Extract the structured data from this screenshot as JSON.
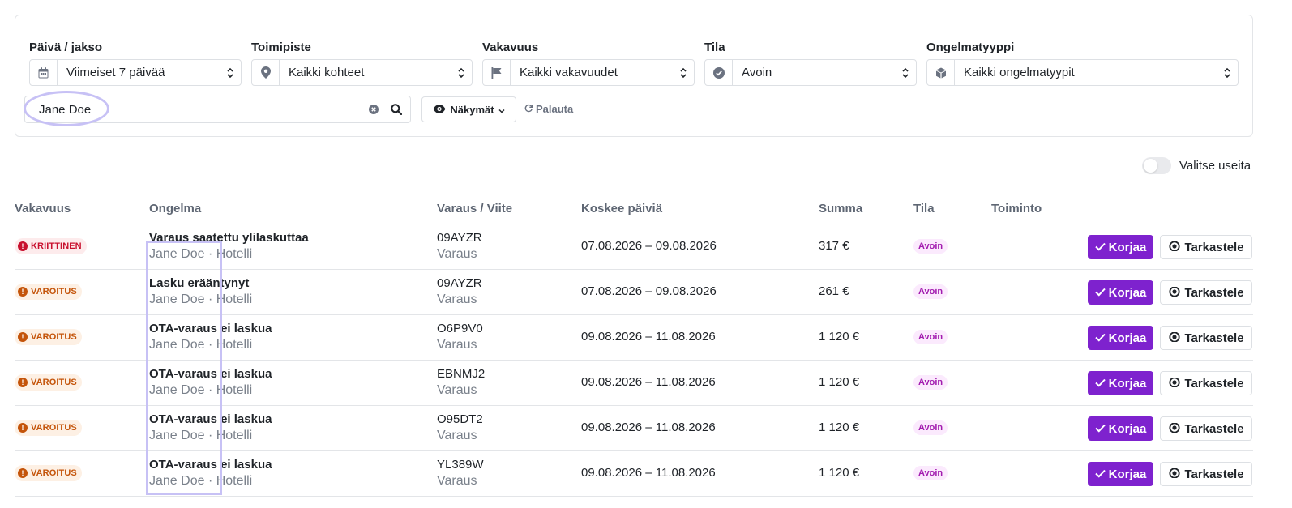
{
  "filters": {
    "date": {
      "label": "Päivä / jakso",
      "value": "Viimeiset 7 päivää",
      "icon": "calendar-icon"
    },
    "location": {
      "label": "Toimipiste",
      "value": "Kaikki kohteet",
      "icon": "map-pin-icon"
    },
    "severity": {
      "label": "Vakavuus",
      "value": "Kaikki vakavuudet",
      "icon": "flag-icon"
    },
    "status": {
      "label": "Tila",
      "value": "Avoin",
      "icon": "check-circle-icon"
    },
    "issue_type": {
      "label": "Ongelmatyyppi",
      "value": "Kaikki ongelmatyypit",
      "icon": "cube-icon"
    }
  },
  "search": {
    "value": "Jane Doe",
    "placeholder": ""
  },
  "views_button": {
    "label": "Näkymät"
  },
  "reset_link": {
    "label": "Palauta"
  },
  "multi_select": {
    "label": "Valitse useita",
    "enabled": false
  },
  "table": {
    "headers": {
      "severity": "Vakavuus",
      "problem": "Ongelma",
      "reference": "Varaus / Viite",
      "dates": "Koskee päiviä",
      "amount": "Summa",
      "status": "Tila",
      "action": "Toiminto"
    },
    "rows": [
      {
        "severity": "KRIITTINEN",
        "severity_level": "critical",
        "title": "Varaus saatettu ylilaskuttaa",
        "subtitle": "Jane Doe · Hotelli",
        "ref_code": "09AYZR",
        "ref_type": "Varaus",
        "dates": "07.08.2026 – 09.08.2026",
        "amount": "317 €",
        "status": "Avoin",
        "fix_label": "Korjaa",
        "view_label": "Tarkastele"
      },
      {
        "severity": "VAROITUS",
        "severity_level": "warning",
        "title": "Lasku erääntynyt",
        "subtitle": "Jane Doe · Hotelli",
        "ref_code": "09AYZR",
        "ref_type": "Varaus",
        "dates": "07.08.2026 – 09.08.2026",
        "amount": "261 €",
        "status": "Avoin",
        "fix_label": "Korjaa",
        "view_label": "Tarkastele"
      },
      {
        "severity": "VAROITUS",
        "severity_level": "warning",
        "title": "OTA-varaus ei laskua",
        "subtitle": "Jane Doe · Hotelli",
        "ref_code": "O6P9V0",
        "ref_type": "Varaus",
        "dates": "09.08.2026 – 11.08.2026",
        "amount": "1 120 €",
        "status": "Avoin",
        "fix_label": "Korjaa",
        "view_label": "Tarkastele"
      },
      {
        "severity": "VAROITUS",
        "severity_level": "warning",
        "title": "OTA-varaus ei laskua",
        "subtitle": "Jane Doe · Hotelli",
        "ref_code": "EBNMJ2",
        "ref_type": "Varaus",
        "dates": "09.08.2026 – 11.08.2026",
        "amount": "1 120 €",
        "status": "Avoin",
        "fix_label": "Korjaa",
        "view_label": "Tarkastele"
      },
      {
        "severity": "VAROITUS",
        "severity_level": "warning",
        "title": "OTA-varaus ei laskua",
        "subtitle": "Jane Doe · Hotelli",
        "ref_code": "O95DT2",
        "ref_type": "Varaus",
        "dates": "09.08.2026 – 11.08.2026",
        "amount": "1 120 €",
        "status": "Avoin",
        "fix_label": "Korjaa",
        "view_label": "Tarkastele"
      },
      {
        "severity": "VAROITUS",
        "severity_level": "warning",
        "title": "OTA-varaus ei laskua",
        "subtitle": "Jane Doe · Hotelli",
        "ref_code": "YL389W",
        "ref_type": "Varaus",
        "dates": "09.08.2026 – 11.08.2026",
        "amount": "1 120 €",
        "status": "Avoin",
        "fix_label": "Korjaa",
        "view_label": "Tarkastele"
      }
    ]
  },
  "colors": {
    "primary": "#7e22ce",
    "critical": "#c8102e",
    "warning": "#c4540a",
    "status_open": "#a21caf",
    "highlight": "#c7c1f5"
  }
}
